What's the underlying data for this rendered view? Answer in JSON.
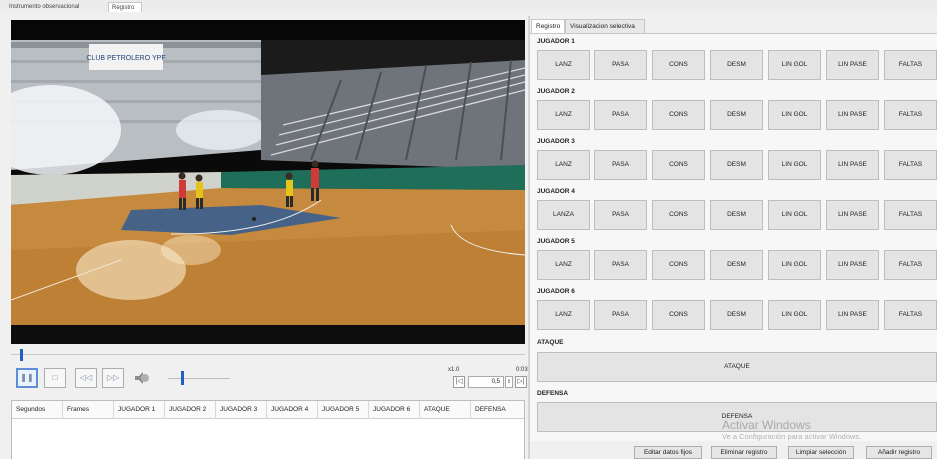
{
  "top_tabs": [
    {
      "label": "Instrumento observacional"
    },
    {
      "label": "Registro"
    }
  ],
  "player": {
    "speed": "x1.0",
    "time": "0:03",
    "step_value": "0,5"
  },
  "table": {
    "columns": [
      "Segundos",
      "Frames",
      "JUGADOR 1",
      "JUGADOR 2",
      "JUGADOR 3",
      "JUGADOR 4",
      "JUGADOR 5",
      "JUGADOR 6",
      "ATAQUE",
      "DEFENSA"
    ],
    "rows": []
  },
  "right_tabs": [
    {
      "label": "Registro"
    },
    {
      "label": "Visualizacion selectiva"
    }
  ],
  "players": [
    {
      "label": "JUGADOR 1",
      "actions": [
        "LANZ",
        "PASA",
        "CONS",
        "DESM",
        "LIN GOL",
        "LIN PASE",
        "FALTAS"
      ]
    },
    {
      "label": "JUGADOR 2",
      "actions": [
        "LANZ",
        "PASA",
        "CONS",
        "DESM",
        "LIN GOL",
        "LIN PASE",
        "FALTAS"
      ]
    },
    {
      "label": "JUGADOR 3",
      "actions": [
        "LANZ",
        "PASA",
        "CONS",
        "DESM",
        "LIN GOL",
        "LIN PASE",
        "FALTAS"
      ]
    },
    {
      "label": "JUGADOR 4",
      "actions": [
        "LANZA",
        "PASA",
        "CONS",
        "DESM",
        "LIN GOL",
        "LIN PASE",
        "FALTAS"
      ]
    },
    {
      "label": "JUGADOR 5",
      "actions": [
        "LANZ",
        "PASA",
        "CONS",
        "DESM",
        "LIN GOL",
        "LIN PASE",
        "FALTAS"
      ]
    },
    {
      "label": "JUGADOR 6",
      "actions": [
        "LANZ",
        "PASA",
        "CONS",
        "DESM",
        "LIN GOL",
        "LIN PASE",
        "FALTAS"
      ]
    }
  ],
  "attack": {
    "label": "ATAQUE",
    "button": "ATAQUE"
  },
  "defense": {
    "label": "DEFENSA",
    "button": "DEFENSA"
  },
  "bottom_buttons": [
    "Editar datos fijos",
    "Eliminar registro",
    "Limpiar selección",
    "Añadir registro"
  ],
  "watermark": {
    "line1": "Activar Windows",
    "line2": "Ve a Configuración para activar Windows."
  },
  "video": {
    "banner_text": "CLUB PETROLERO YPF",
    "accent_color": "#2060c0"
  }
}
